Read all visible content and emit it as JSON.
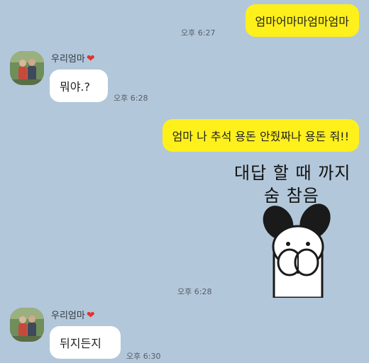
{
  "messages": {
    "m1_text": "엄마어마마엄마엄마",
    "m1_time": "오후 6:27",
    "m2_sender": "우리엄마",
    "m2_text": "뭐야.?",
    "m2_time": "오후 6:28",
    "m3_text": "엄마 나 추석 용돈 안줬짜나 용돈 줘!!",
    "m4_sticker_line1": "대답 할 때 까지",
    "m4_sticker_line2": "숨 참음",
    "m4_time": "오후 6:28",
    "m5_sender": "우리엄마",
    "m5_text": "뒤지든지",
    "m5_time": "오후 6:30"
  },
  "colors": {
    "background": "#b2c7da",
    "outgoing_bubble": "#fef01b",
    "incoming_bubble": "#ffffff",
    "heart": "#e0342f"
  },
  "icons": {
    "sender_heart": "heart-emoji",
    "avatar": "profile-photo",
    "sticker": "rabbit-holding-breath-sticker"
  }
}
